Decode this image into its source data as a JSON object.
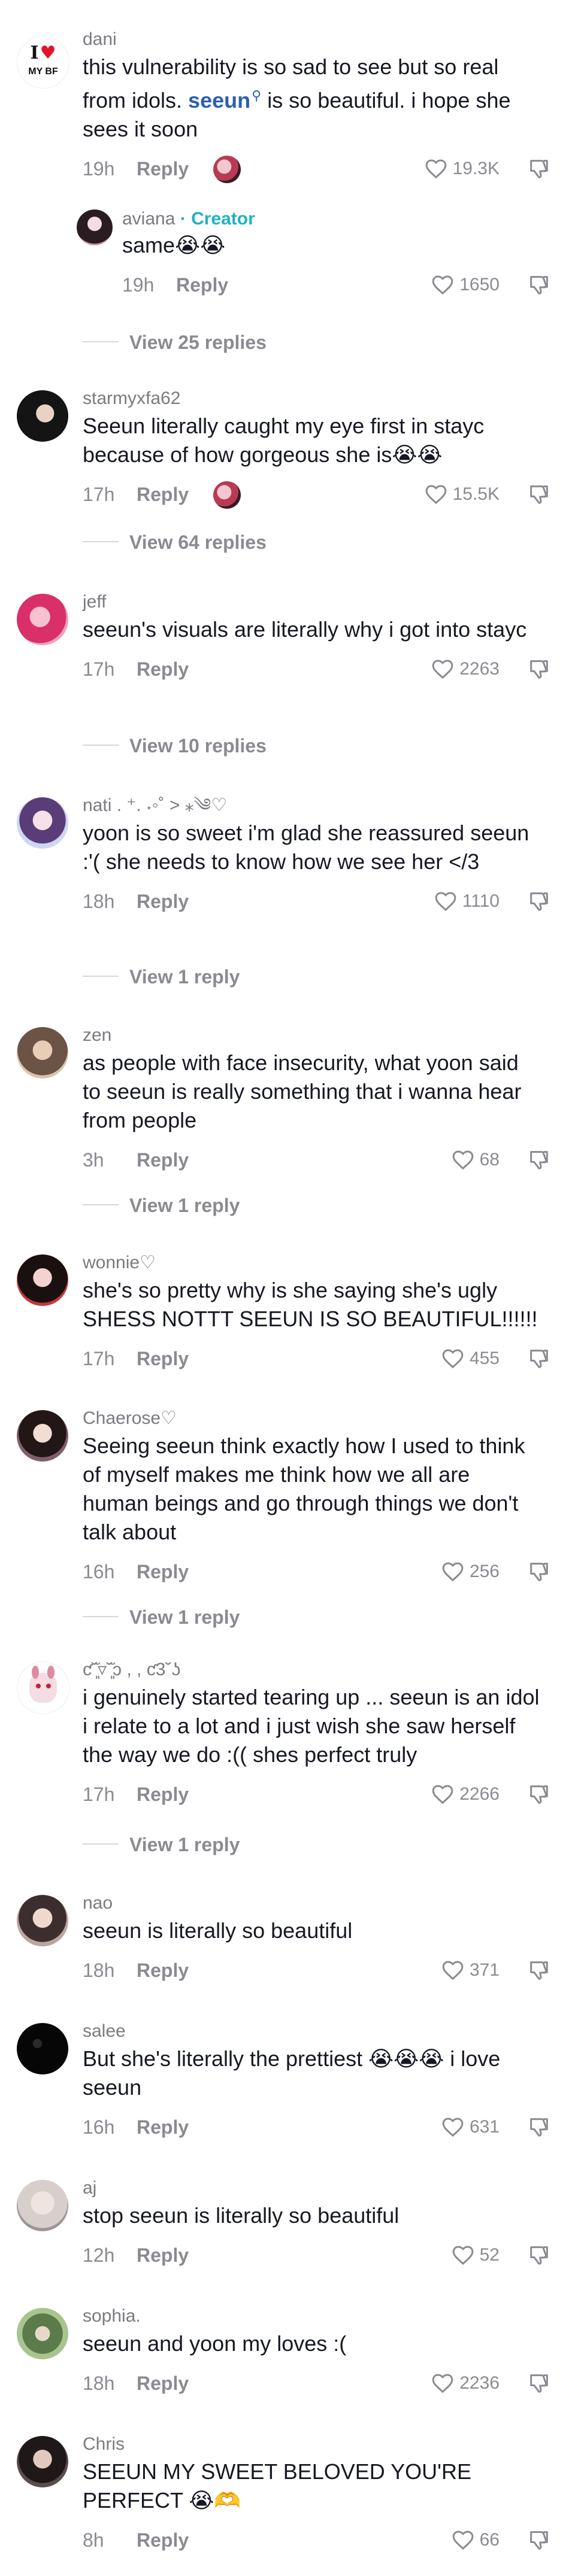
{
  "comments": [
    {
      "username": "dani",
      "text_parts": [
        "this vulnerability is so sad to see but so real from idols. ",
        "seeun",
        " is so beautiful. i hope she sees it soon"
      ],
      "time": "19h",
      "reply_label": "Reply",
      "likes": "19.3K",
      "creator_liked": true,
      "avatar_text": {
        "top": "I",
        "heart": "♥",
        "bottom": "MY BF"
      },
      "reply": {
        "username": "aviana",
        "creator_label": "· Creator",
        "text": "same😭😭",
        "time": "19h",
        "reply_label": "Reply",
        "likes": "1650"
      },
      "view_replies": "View 25 replies"
    },
    {
      "username": "starmyxfa62",
      "text": "Seeun literally caught my eye first in stayc because of how gorgeous she is😭😭",
      "time": "17h",
      "reply_label": "Reply",
      "likes": "15.5K",
      "creator_liked": true,
      "view_replies": "View 64 replies"
    },
    {
      "username": "jeff",
      "text": "seeun's visuals are literally why i got into stayc",
      "time": "17h",
      "reply_label": "Reply",
      "likes": "2263",
      "view_replies": "View 10 replies"
    },
    {
      "username": "nati . ⁺. ˖◦˚ ˃ ⁎༄♡",
      "text": "yoon is so sweet i'm glad she reassured seeun :'( she needs to know how we see her </3",
      "time": "18h",
      "reply_label": "Reply",
      "likes": "1110",
      "view_replies": "View 1 reply"
    },
    {
      "username": "zen",
      "text": "as people with face insecurity, what yoon said to seeun is really something that i wanna hear from people",
      "time": "3h",
      "reply_label": "Reply",
      "likes": "68",
      "view_replies": "View 1 reply"
    },
    {
      "username": "wonnie♡",
      "text": "she's so pretty why is she saying she's ugly SHESS NOTTT SEEUN IS SO BEAUTIFUL!!!!!!",
      "time": "17h",
      "reply_label": "Reply",
      "likes": "455"
    },
    {
      "username": "Chaerose♡",
      "text": "Seeing seeun think exactly how I used to think of myself makes me think how we all are human beings and go through things we don't talk about",
      "time": "16h",
      "reply_label": "Reply",
      "likes": "256",
      "view_replies": "View 1 reply"
    },
    {
      "username": "ƈ˘͈̆▿˘͈̆ɔ , , ƈ3˘ʖ",
      "text": "i genuinely started tearing up ... seeun is an idol i relate to a lot and i just wish she saw herself the way we do :(( shes perfect truly",
      "time": "17h",
      "reply_label": "Reply",
      "likes": "2266",
      "view_replies": "View 1 reply"
    },
    {
      "username": "nao",
      "text": "seeun is literally so beautiful",
      "time": "18h",
      "reply_label": "Reply",
      "likes": "371"
    },
    {
      "username": "salee",
      "text": "But she's literally the prettiest 😭😭😭 i love seeun",
      "time": "16h",
      "reply_label": "Reply",
      "likes": "631"
    },
    {
      "username": "aj",
      "text": "stop seeun is literally so beautiful",
      "time": "12h",
      "reply_label": "Reply",
      "likes": "52"
    },
    {
      "username": "sophia.",
      "text": "seeun and yoon my loves :(",
      "time": "18h",
      "reply_label": "Reply",
      "likes": "2236"
    },
    {
      "username": "Chris",
      "text": "SEEUN MY SWEET BELOVED YOU'RE PERFECT 😭🫶",
      "time": "8h",
      "reply_label": "Reply",
      "likes": "66"
    }
  ]
}
